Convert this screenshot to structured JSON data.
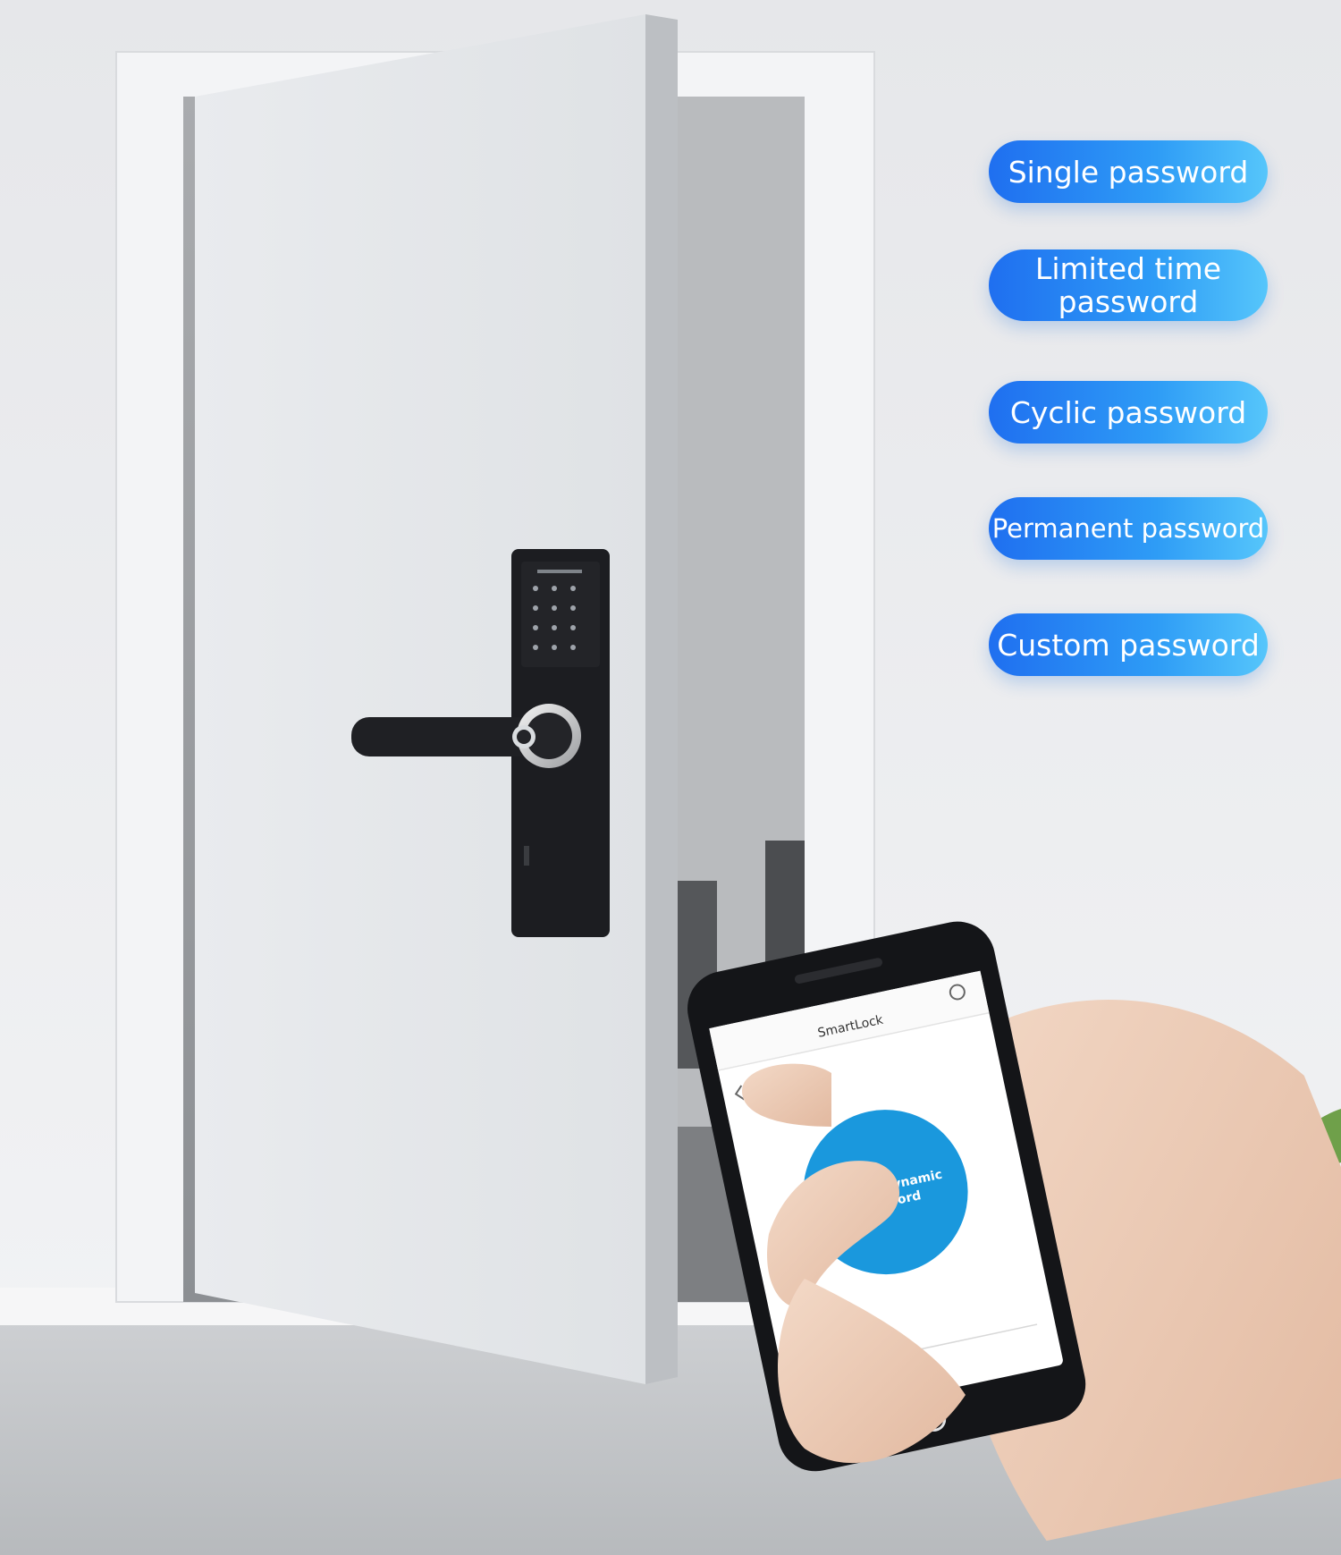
{
  "features": [
    {
      "label": "Single password"
    },
    {
      "label": "Limited time\npassword"
    },
    {
      "label": "Cyclic password"
    },
    {
      "label": "Permanent password"
    },
    {
      "label": "Custom password"
    }
  ],
  "phone": {
    "app_title": "SmartLock",
    "button_label": "Remote dynamic password"
  },
  "colors": {
    "accent_blue": "#1a98dd",
    "pill_gradient_start": "#1f6ff0",
    "pill_gradient_end": "#56c6fb",
    "lock_body": "#1c1d21"
  }
}
